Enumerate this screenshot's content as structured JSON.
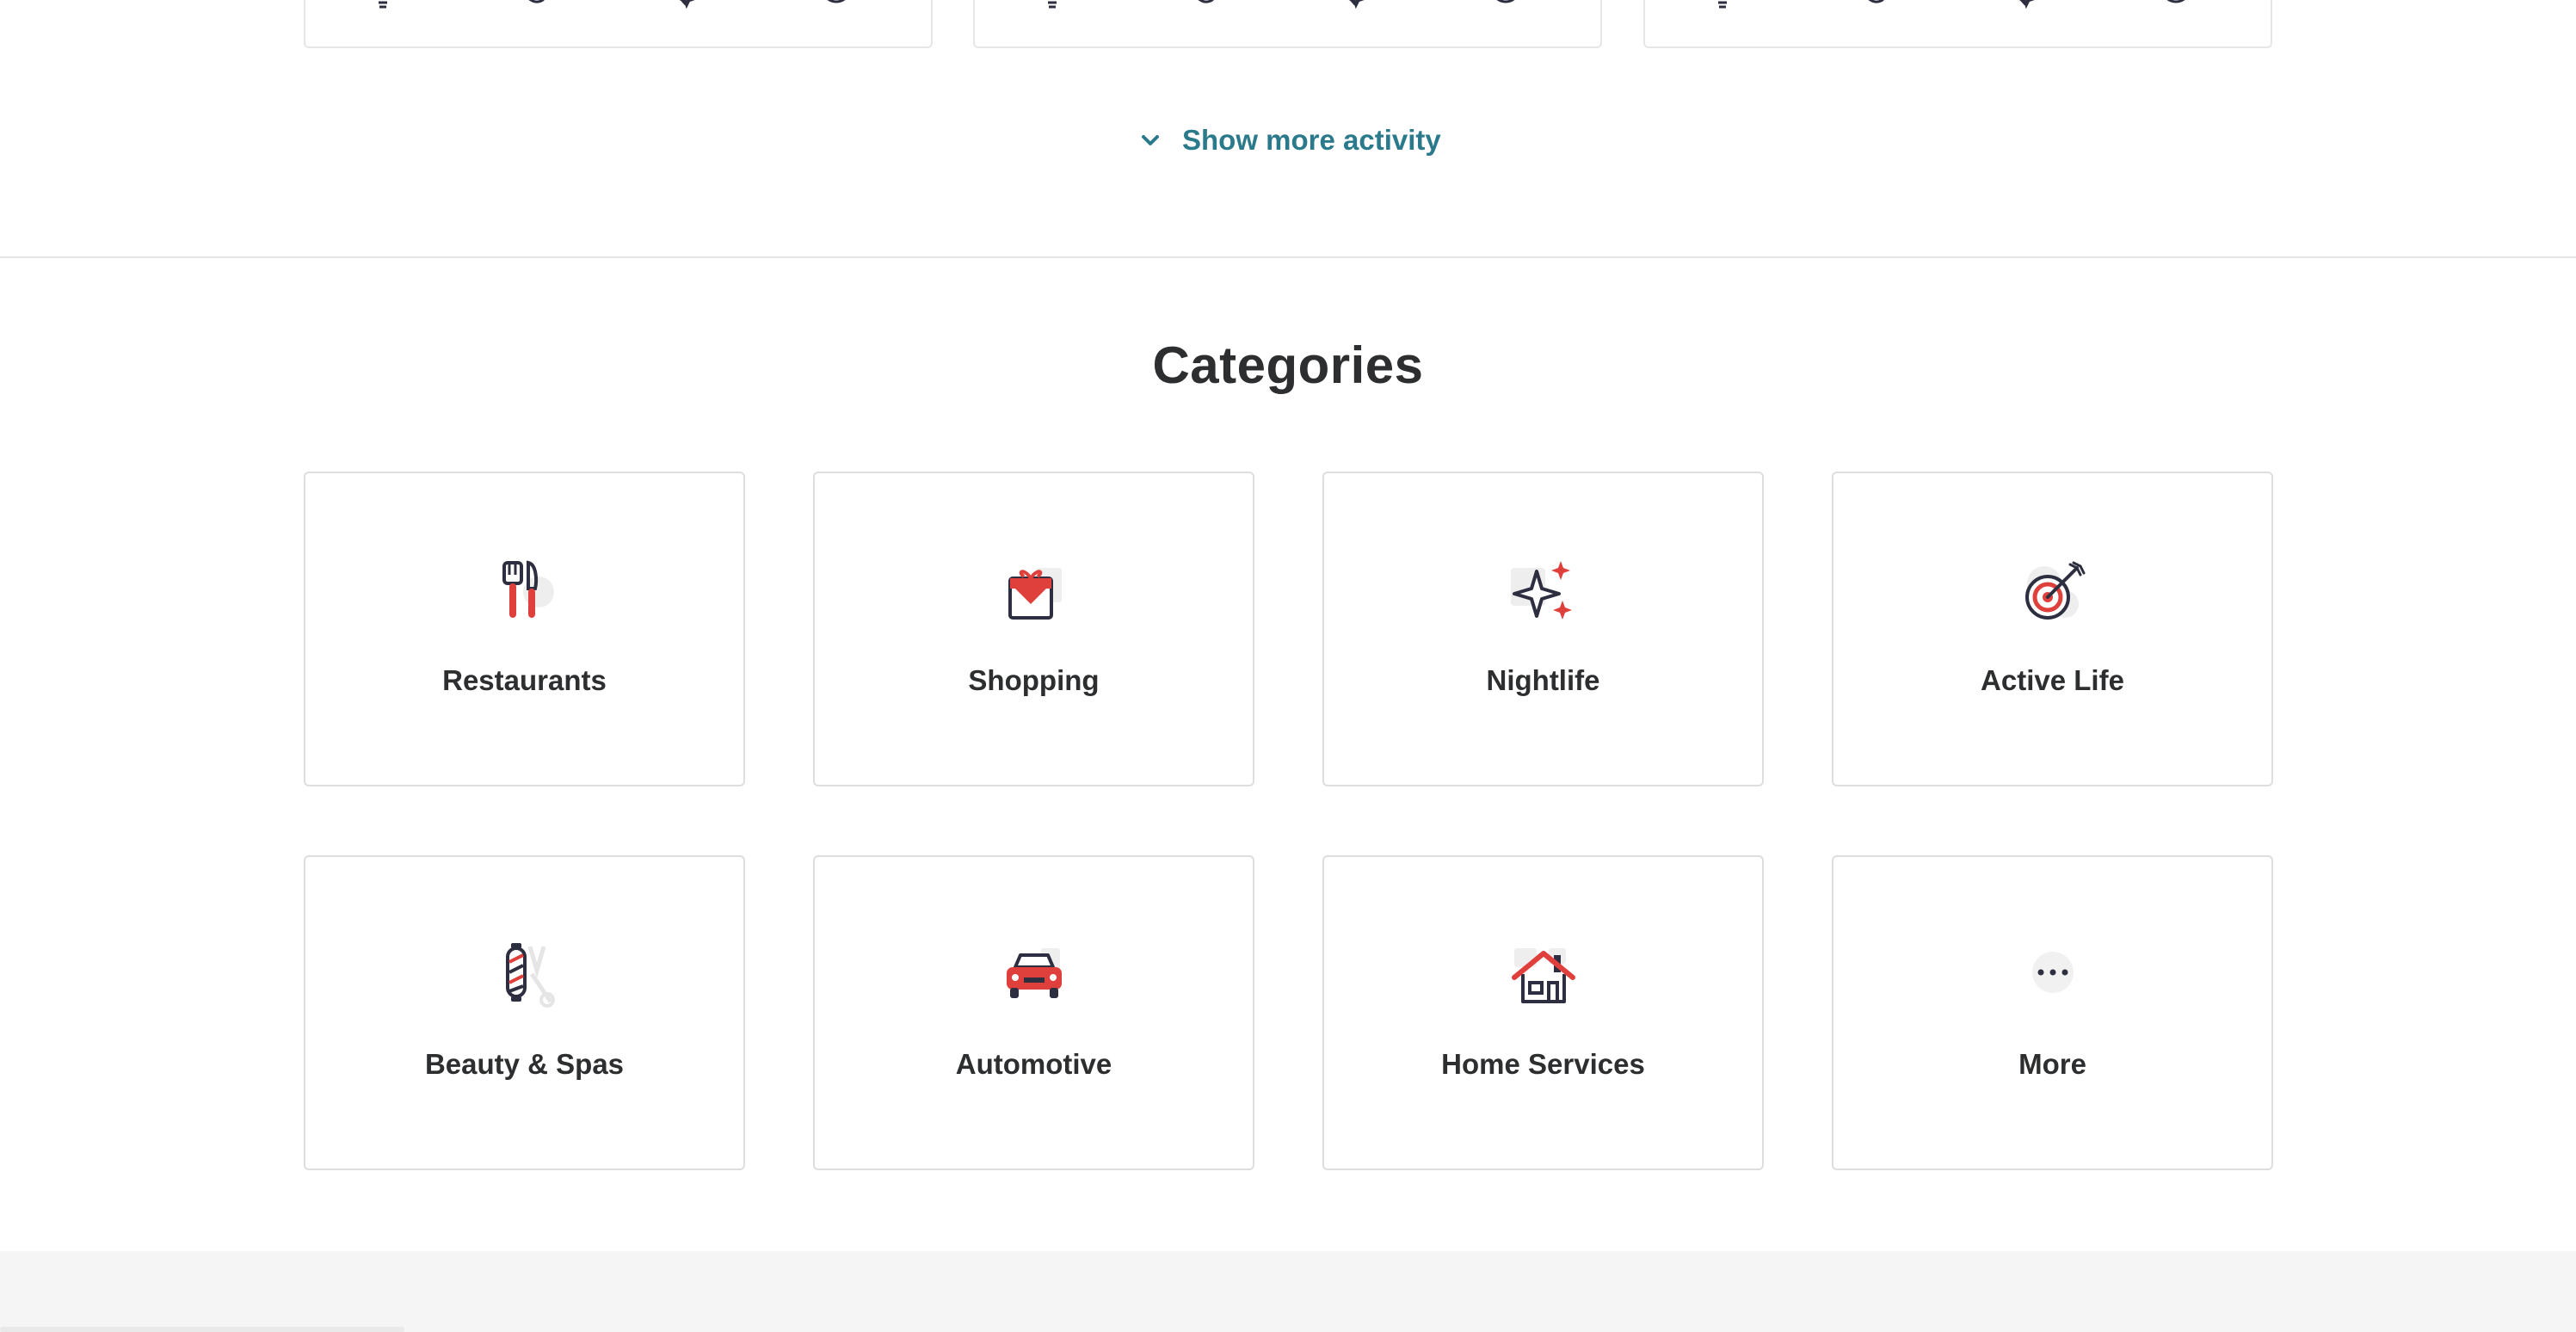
{
  "activity": {
    "cards": [
      {
        "reactions": [
          "lightbulb-icon",
          "thumbs-up-icon",
          "love-icon",
          "oh-no-icon"
        ]
      },
      {
        "reactions": [
          "lightbulb-icon",
          "thumbs-up-icon",
          "love-icon",
          "oh-no-icon"
        ]
      },
      {
        "reactions": [
          "lightbulb-icon",
          "thumbs-up-icon",
          "love-icon",
          "oh-no-icon"
        ]
      }
    ],
    "show_more_label": "Show more activity"
  },
  "categories": {
    "title": "Categories",
    "items": [
      {
        "label": "Restaurants",
        "icon": "restaurants-icon"
      },
      {
        "label": "Shopping",
        "icon": "shopping-icon"
      },
      {
        "label": "Nightlife",
        "icon": "nightlife-icon"
      },
      {
        "label": "Active Life",
        "icon": "active-life-icon"
      },
      {
        "label": "Beauty & Spas",
        "icon": "beauty-spas-icon"
      },
      {
        "label": "Automotive",
        "icon": "automotive-icon"
      },
      {
        "label": "Home Services",
        "icon": "home-services-icon"
      },
      {
        "label": "More",
        "icon": "more-icon"
      }
    ]
  },
  "colors": {
    "accent_red": "#e0403c",
    "link_teal": "#2b7a8c",
    "icon_dark": "#2d2e3f",
    "border": "#dedede"
  }
}
